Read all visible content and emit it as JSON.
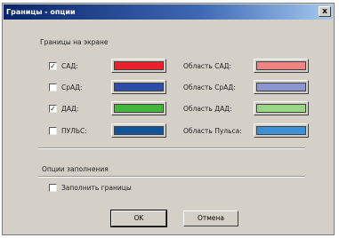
{
  "window": {
    "title": "Границы - опции",
    "close_label": "x"
  },
  "borders_group": {
    "title": "Границы на экране",
    "rows": [
      {
        "check_label": "САД:",
        "checked": "✓",
        "line_color": "#e8222d",
        "area_label": "Область САД:",
        "area_color": "#ee8585"
      },
      {
        "check_label": "СрАД:",
        "checked": "",
        "line_color": "#2c4ea8",
        "area_label": "Область СрАД:",
        "area_color": "#8b95cf"
      },
      {
        "check_label": "ДАД:",
        "checked": "✓",
        "line_color": "#45b53e",
        "area_label": "Область ДАД:",
        "area_color": "#9ad785"
      },
      {
        "check_label": "ПУЛЬС:",
        "checked": "",
        "line_color": "#10559a",
        "area_label": "Область Пульса:",
        "area_color": "#3c90d8"
      }
    ]
  },
  "fill_group": {
    "title": "Опции заполнения",
    "fill_label": "Заполнить границы",
    "fill_checked": ""
  },
  "buttons": {
    "ok": "OK",
    "cancel": "Отмена"
  }
}
